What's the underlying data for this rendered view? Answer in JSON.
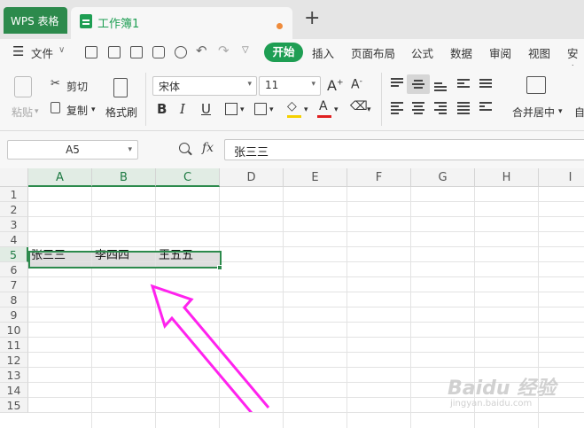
{
  "titlebar": {
    "app_tab": "WPS 表格",
    "doc_tab": "工作簿1",
    "new_tab": "+"
  },
  "menubar": {
    "file": "文件",
    "start": "开始",
    "items": [
      "插入",
      "页面布局",
      "公式",
      "数据",
      "审阅",
      "视图",
      "安全"
    ]
  },
  "ribbon": {
    "paste": "粘贴",
    "cut": "剪切",
    "copy": "复制",
    "format_painter": "格式刷",
    "font_name": "宋体",
    "font_size": "11",
    "bold": "B",
    "italic": "I",
    "underline": "U",
    "merge_center": "合并居中",
    "auto_wrap_partial": "自"
  },
  "formula_bar": {
    "name_box": "A5",
    "fx": "fx",
    "content": "张三三"
  },
  "grid": {
    "columns": [
      "A",
      "B",
      "C",
      "D",
      "E",
      "F",
      "G",
      "H",
      "I"
    ],
    "rows": [
      "1",
      "2",
      "3",
      "4",
      "5",
      "6",
      "7",
      "8",
      "9",
      "10",
      "11",
      "12",
      "13",
      "14",
      "15"
    ],
    "row5": [
      "张三三",
      "李四四",
      "王五五"
    ]
  },
  "colors": {
    "accent": "#2c8a4c",
    "annotation_arrow": "#ff22ee"
  },
  "watermark": {
    "logo": "Baidu 经验",
    "url": "jingyan.baidu.com"
  }
}
